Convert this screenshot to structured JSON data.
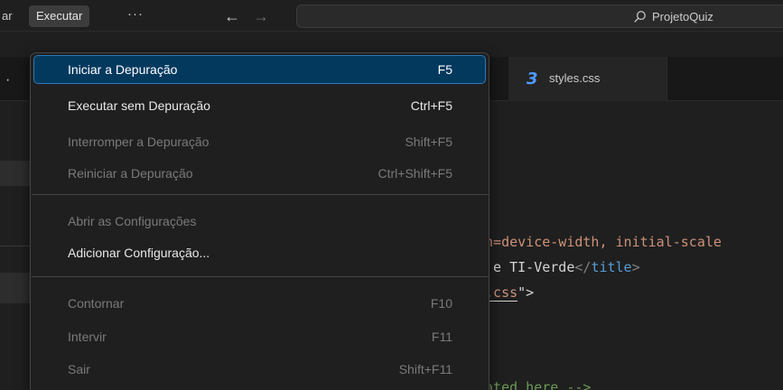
{
  "titlebar": {
    "menu_cut": "ar",
    "menu_active": "Executar",
    "more": "···",
    "search_text": "ProjetoQuiz"
  },
  "tabs": {
    "left_tab_glyph": "·",
    "styles_icon": "3",
    "styles_label": "styles.css"
  },
  "editor": {
    "line1_part1": "th=device-width, initial-scale",
    "line2_part1": "e e TI-Verde",
    "line2_tag": "title",
    "line3_part1": "s.css",
    "line3_part2": "\">",
    "line4": "eated here -->"
  },
  "menu": {
    "items": [
      {
        "label": "Iniciar a Depuração",
        "shortcut": "F5",
        "state": "active"
      },
      {
        "label": "Executar sem Depuração",
        "shortcut": "Ctrl+F5",
        "state": "enabled"
      },
      {
        "label": "Interromper a Depuração",
        "shortcut": "Shift+F5",
        "state": "disabled"
      },
      {
        "label": "Reiniciar a Depuração",
        "shortcut": "Ctrl+Shift+F5",
        "state": "disabled"
      },
      {
        "label": "Abrir as Configurações",
        "shortcut": "",
        "state": "disabled"
      },
      {
        "label": "Adicionar Configuração...",
        "shortcut": "",
        "state": "enabled"
      },
      {
        "label": "Contornar",
        "shortcut": "F10",
        "state": "disabled"
      },
      {
        "label": "Intervir",
        "shortcut": "F11",
        "state": "disabled"
      },
      {
        "label": "Sair",
        "shortcut": "Shift+F11",
        "state": "disabled"
      }
    ]
  },
  "colors": {
    "accent": "#04395e",
    "background": "#1f1f1f"
  }
}
